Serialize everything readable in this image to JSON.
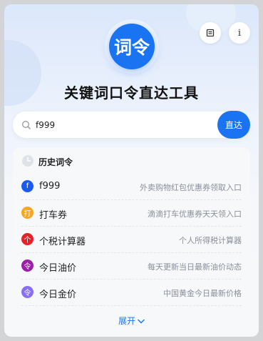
{
  "app": {
    "logo_text": "词令",
    "title": "关键词口令直达工具",
    "brand_color": "#1a73f0"
  },
  "top_buttons": {
    "bookmark_icon": "bookmark-icon",
    "info_icon": "info-icon",
    "info_glyph": "i"
  },
  "search": {
    "value": "f999",
    "button_label": "直达"
  },
  "history": {
    "title": "历史词令",
    "items": [
      {
        "icon_text": "f",
        "icon_color": "#1a5af0",
        "name": "f999",
        "desc": "外卖购物红包优惠券领取入口"
      },
      {
        "icon_text": "打",
        "icon_color": "#f5a623",
        "name": "打车券",
        "desc": "滴滴打车优惠券天天领入口"
      },
      {
        "icon_text": "个",
        "icon_color": "#e8202a",
        "name": "个税计算器",
        "desc": "个人所得税计算器"
      },
      {
        "icon_text": "令",
        "icon_color": "#9b1fa8",
        "name": "今日油价",
        "desc": "每天更新当日最新油价动态"
      },
      {
        "icon_text": "令",
        "icon_color": "#8b6ff2",
        "name": "今日金价",
        "desc": "中国黄金今日最新价格"
      }
    ],
    "expand_label": "展开"
  }
}
